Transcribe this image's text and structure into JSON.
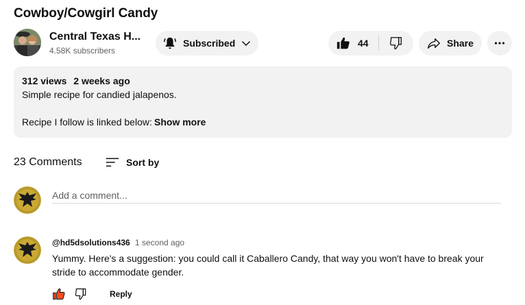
{
  "video": {
    "title": "Cowboy/Cowgirl Candy"
  },
  "channel": {
    "name": "Central Texas H...",
    "subscribers": "4.58K subscribers"
  },
  "actions": {
    "subscribe_label": "Subscribed",
    "like_count": "44",
    "share_label": "Share"
  },
  "description": {
    "views": "312 views",
    "age": "2 weeks ago",
    "line1": "Simple recipe for candied jalapenos.",
    "line2": "Recipe I follow is linked below:",
    "show_more": "Show more"
  },
  "comments": {
    "count_label": "23 Comments",
    "sort_label": "Sort by",
    "add_placeholder": "Add a comment...",
    "items": [
      {
        "author": "@hd5dsolutions436",
        "time": "1 second ago",
        "text": "Yummy. Here's a suggestion: you could call it Caballero Candy, that way you won't have to break your stride to accommodate gender.",
        "reply_label": "Reply"
      }
    ]
  },
  "icons": {
    "bell": "bell-icon",
    "chevron": "chevron-down-icon",
    "like": "thumbs-up-icon",
    "dislike": "thumbs-down-icon",
    "share": "share-arrow-icon",
    "more": "more-horizontal-icon",
    "sort": "sort-lines-icon"
  },
  "colors": {
    "like_active": "#ff4e1f",
    "pill_bg": "#f2f2f2",
    "secondary_text": "#606060"
  }
}
